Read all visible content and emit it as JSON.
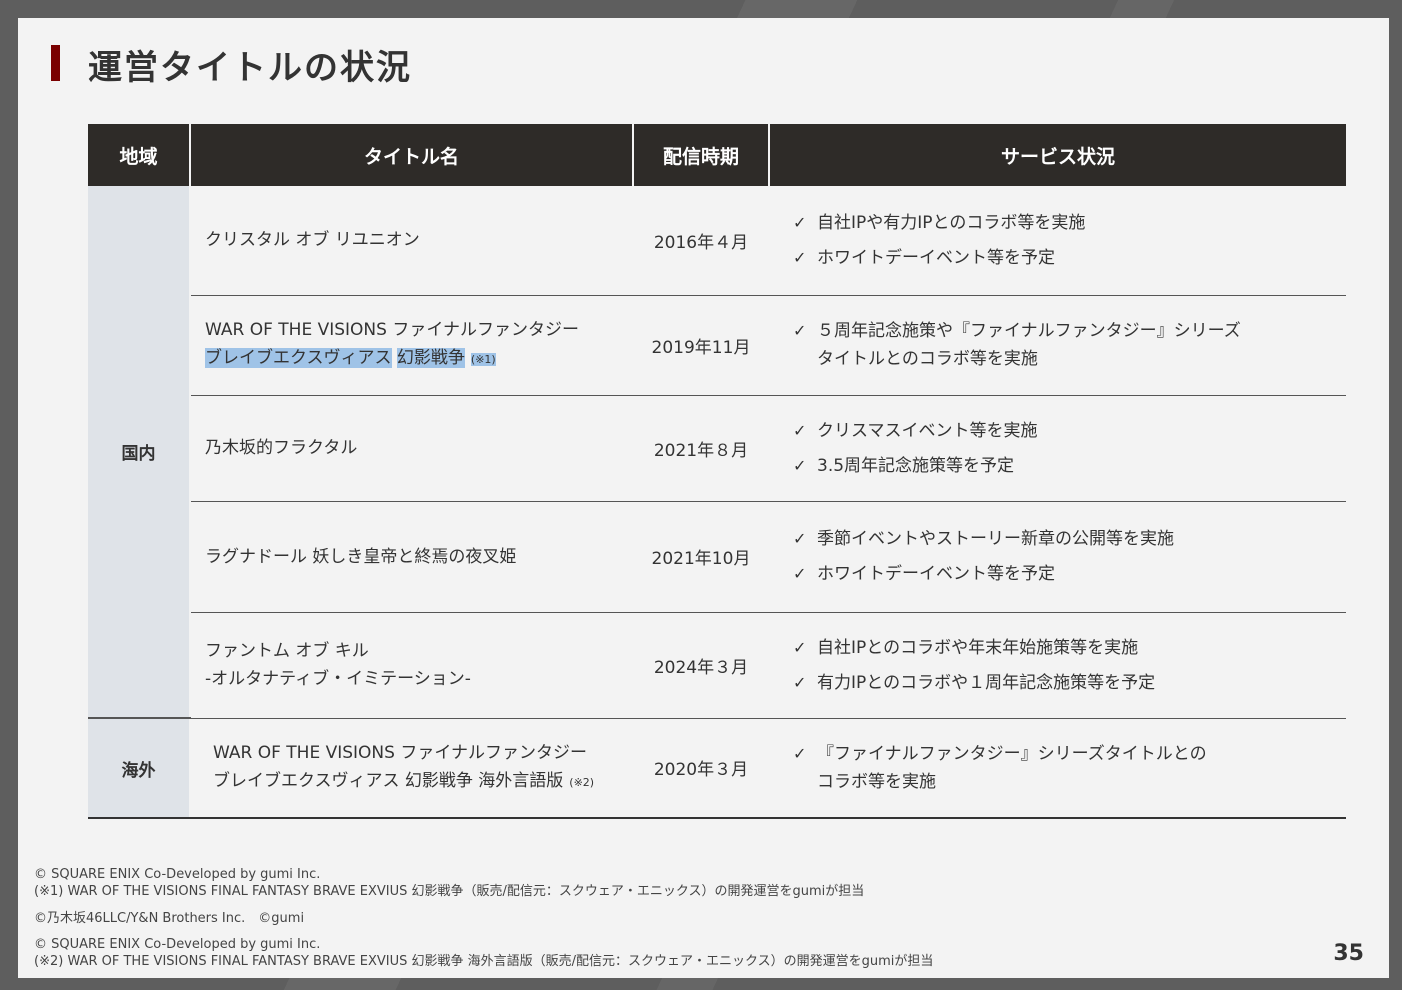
{
  "title": "運営タイトルの状況",
  "table": {
    "headers": [
      "地域",
      "タイトル名",
      "配信時期",
      "サービス状況"
    ],
    "domestic_label": "国内",
    "overseas_label": "海外",
    "domestic_rows": [
      {
        "title_line1": "クリスタル オブ リユニオン",
        "title_line2": "",
        "title_hl": "",
        "note": "",
        "date": "2016年４月",
        "services": [
          "自社IPや有力IPとのコラボ等を実施",
          "ホワイトデーイベント等を予定"
        ]
      },
      {
        "title_line1": "WAR OF THE VISIONS ファイナルファンタジー",
        "title_line2": "ブレイブエクスヴィアス",
        "title_hl": "幻影戦争",
        "note": "(※1)",
        "date": "2019年11月",
        "services": [
          "５周年記念施策や『ファイナルファンタジー』シリーズ\nタイトルとのコラボ等を実施"
        ]
      },
      {
        "title_line1": "乃木坂的フラクタル",
        "title_line2": "",
        "title_hl": "",
        "note": "",
        "date": "2021年８月",
        "services": [
          "クリスマスイベント等を実施",
          "3.5周年記念施策等を予定"
        ]
      },
      {
        "title_line1": "ラグナドール 妖しき皇帝と終焉の夜叉姫",
        "title_line2": "",
        "title_hl": "",
        "note": "",
        "date": "2021年10月",
        "services": [
          "季節イベントやストーリー新章の公開等を実施",
          "ホワイトデーイベント等を予定"
        ]
      },
      {
        "title_line1": "ファントム オブ キル",
        "title_line2": "-オルタナティブ・イミテーション-",
        "title_hl": "",
        "note": "",
        "date": "2024年３月",
        "services": [
          "自社IPとのコラボや年末年始施策等を実施",
          "有力IPとのコラボや１周年記念施策等を予定"
        ]
      }
    ],
    "overseas_row": {
      "title_line1": "WAR OF THE VISIONS ファイナルファンタジー",
      "title_line2": "ブレイブエクスヴィアス 幻影戦争 海外言語版",
      "note": "(※2)",
      "date": "2020年３月",
      "services": [
        "『ファイナルファンタジー』シリーズタイトルとの\nコラボ等を実施"
      ]
    }
  },
  "footer": {
    "line1": "© SQUARE ENIX Co-Developed by gumi Inc.",
    "line2": "(※1) WAR OF THE VISIONS FINAL FANTASY BRAVE EXVIUS 幻影戦争（販売/配信元：スクウェア・エニックス）の開発運営をgumiが担当",
    "line3": "©乃木坂46LLC/Y&N Brothers Inc.　©gumi",
    "line4": "© SQUARE ENIX Co-Developed by gumi Inc.",
    "line5": "(※2) WAR OF THE VISIONS FINAL FANTASY BRAVE EXVIUS 幻影戦争 海外言語版（販売/配信元：スクウェア・エニックス）の開発運営をgumiが担当"
  },
  "page_number": "35",
  "colors": {
    "accent": "#7a0000",
    "header_bg": "#2e2b28",
    "region_bg": "#dfe3e8",
    "highlight": "#9fc3e7"
  },
  "icons": {
    "check": "checkmark-icon"
  }
}
